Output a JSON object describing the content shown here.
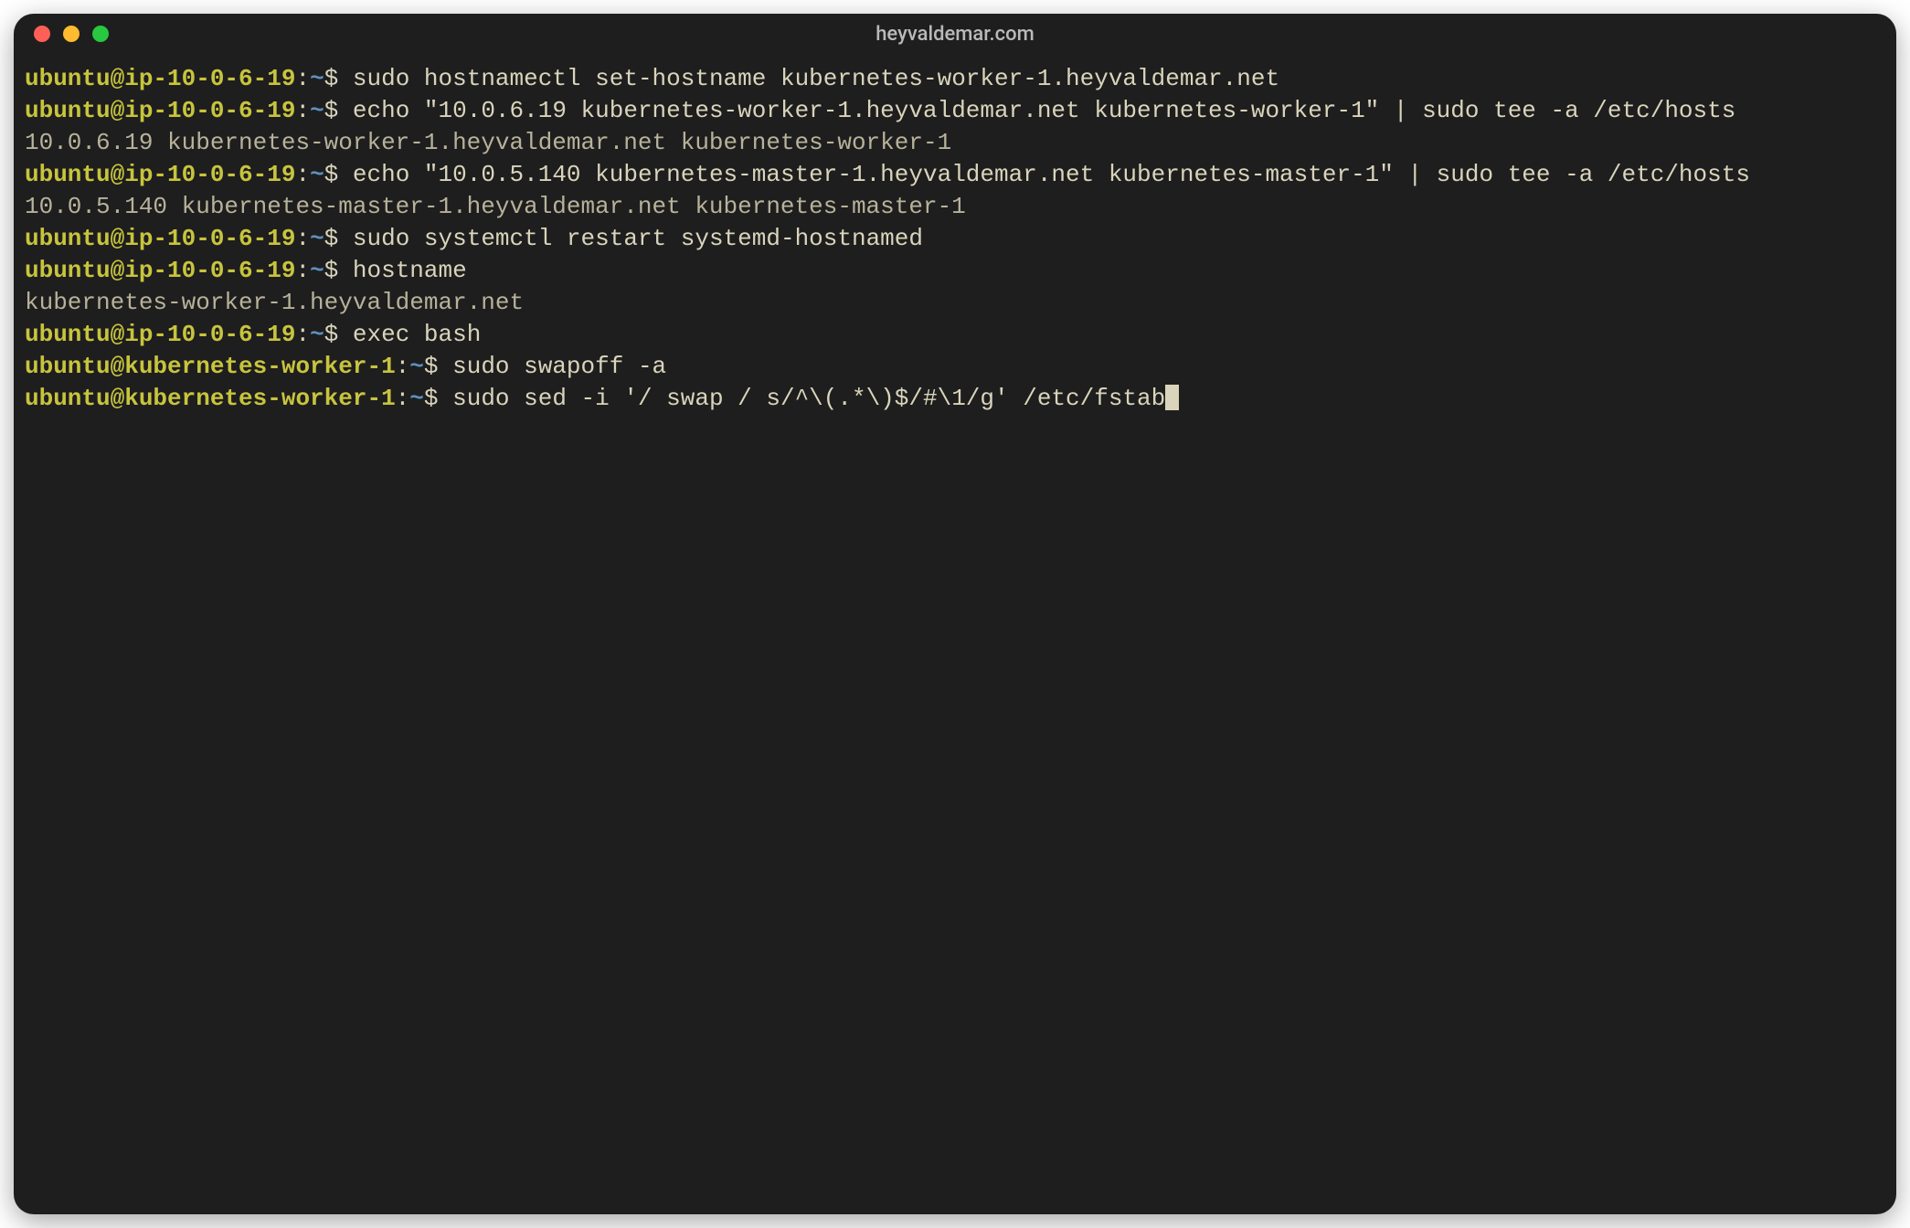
{
  "window": {
    "title": "heyvaldemar.com"
  },
  "prompts": {
    "p1": {
      "user": "ubuntu@ip-10-0-6-19",
      "sep": ":",
      "path": "~",
      "sym": "$ "
    },
    "p2": {
      "user": "ubuntu@kubernetes-worker-1",
      "sep": ":",
      "path": "~",
      "sym": "$ "
    }
  },
  "lines": {
    "l1_cmd": "sudo hostnamectl set-hostname kubernetes-worker-1.heyvaldemar.net",
    "l2_cmd": "echo \"10.0.6.19 kubernetes-worker-1.heyvaldemar.net kubernetes-worker-1\" | sudo tee -a /etc/hosts",
    "l3_out": "10.0.6.19 kubernetes-worker-1.heyvaldemar.net kubernetes-worker-1",
    "l4_cmd": "echo \"10.0.5.140 kubernetes-master-1.heyvaldemar.net kubernetes-master-1\" | sudo tee -a /etc/hosts",
    "l5_out": "10.0.5.140 kubernetes-master-1.heyvaldemar.net kubernetes-master-1",
    "l6_cmd": "sudo systemctl restart systemd-hostnamed",
    "l7_cmd": "hostname",
    "l8_out": "kubernetes-worker-1.heyvaldemar.net",
    "l9_cmd": "exec bash",
    "l10_cmd": "sudo swapoff -a",
    "l11_cmd": "sudo sed -i '/ swap / s/^\\(.*\\)$/#\\1/g' /etc/fstab"
  }
}
